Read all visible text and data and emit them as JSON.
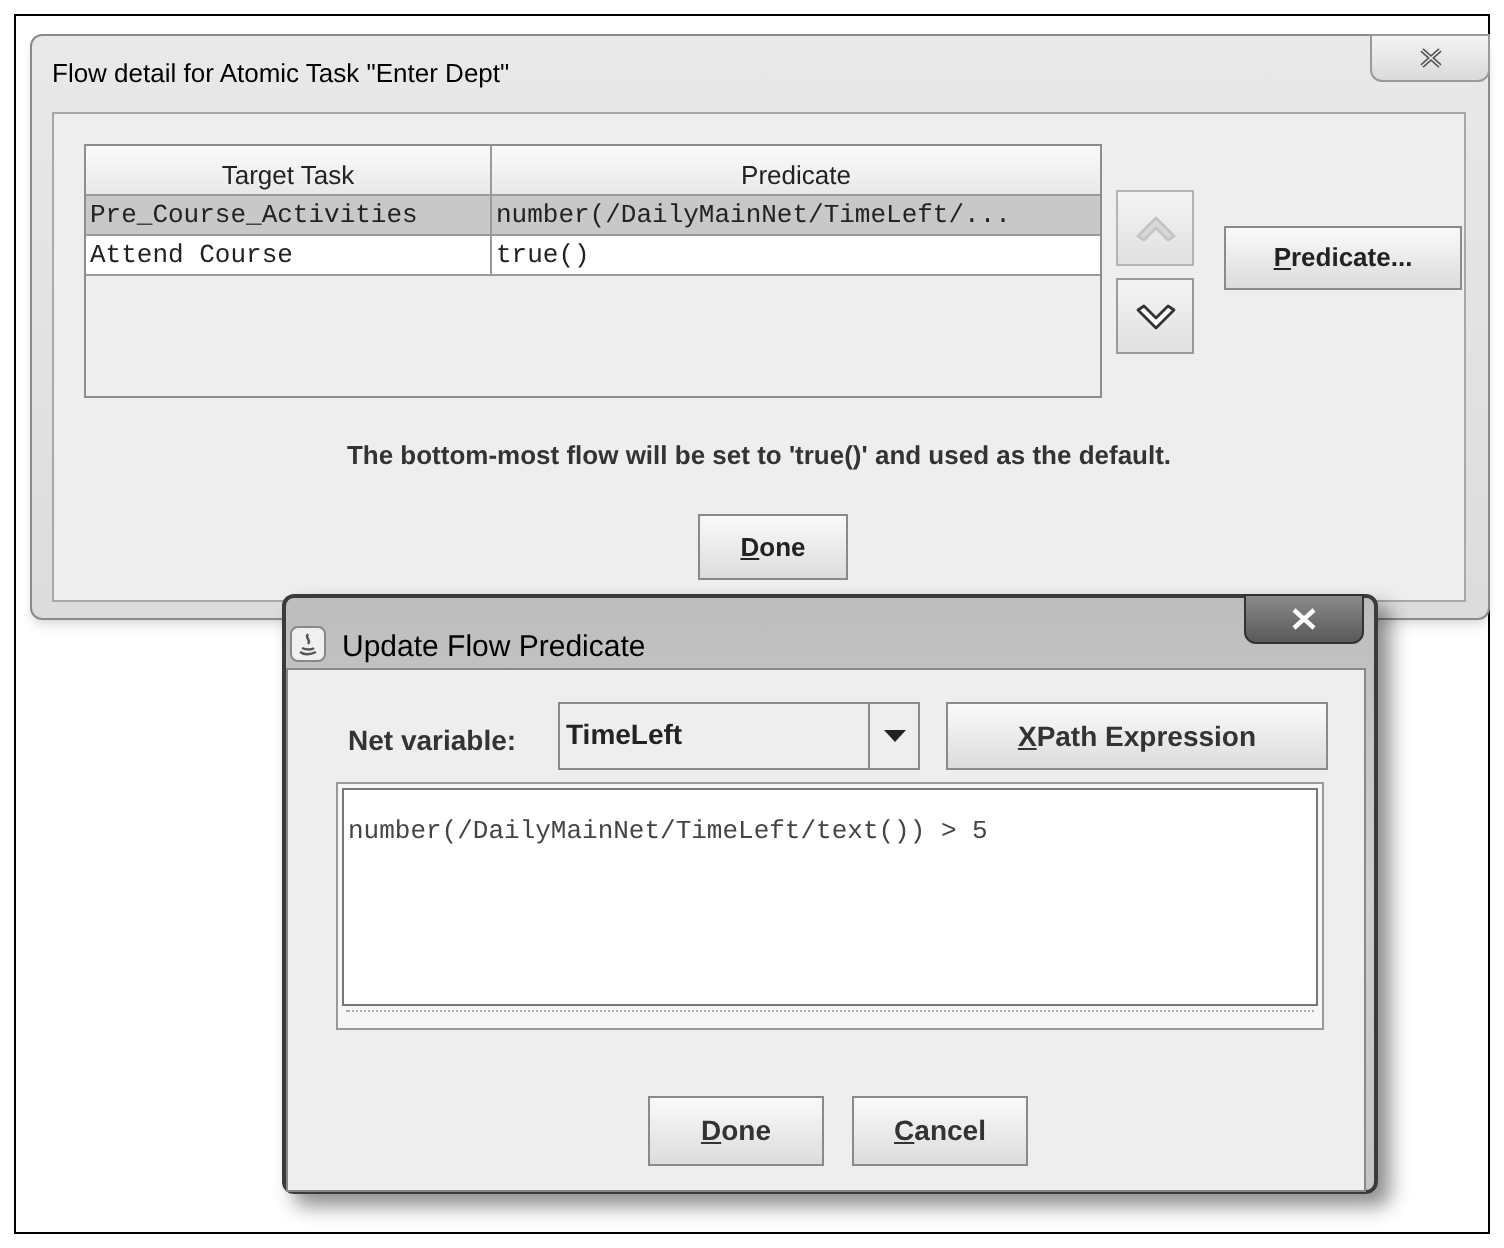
{
  "flow_detail_dialog": {
    "title": "Flow detail for Atomic Task \"Enter Dept\"",
    "table": {
      "columns": [
        "Target Task",
        "Predicate"
      ],
      "rows": [
        {
          "cells": [
            "Pre_Course_Activities",
            "number(/DailyMainNet/TimeLeft/..."
          ],
          "selected": true
        },
        {
          "cells": [
            "Attend Course",
            "true()"
          ],
          "selected": false
        }
      ]
    },
    "move_up_button": {
      "disabled": true
    },
    "move_down_button": {
      "disabled": false
    },
    "predicate_button": {
      "label": "Predicate...",
      "underline_first": true
    },
    "note": "The bottom-most flow will be set to 'true()' and used as the default.",
    "done_button": {
      "label": "Done",
      "underline_first": true
    }
  },
  "update_predicate_dialog": {
    "title": "Update Flow Predicate",
    "active": true,
    "net_variable": {
      "label": "Net variable:",
      "value": "TimeLeft"
    },
    "xpath_button": {
      "label": "XPath Expression",
      "underline_first": true
    },
    "expression": "number(/DailyMainNet/TimeLeft/text()) > 5",
    "buttons": [
      {
        "label": "Done",
        "underline_first": true
      },
      {
        "label": "Cancel",
        "underline_first": true
      }
    ]
  }
}
